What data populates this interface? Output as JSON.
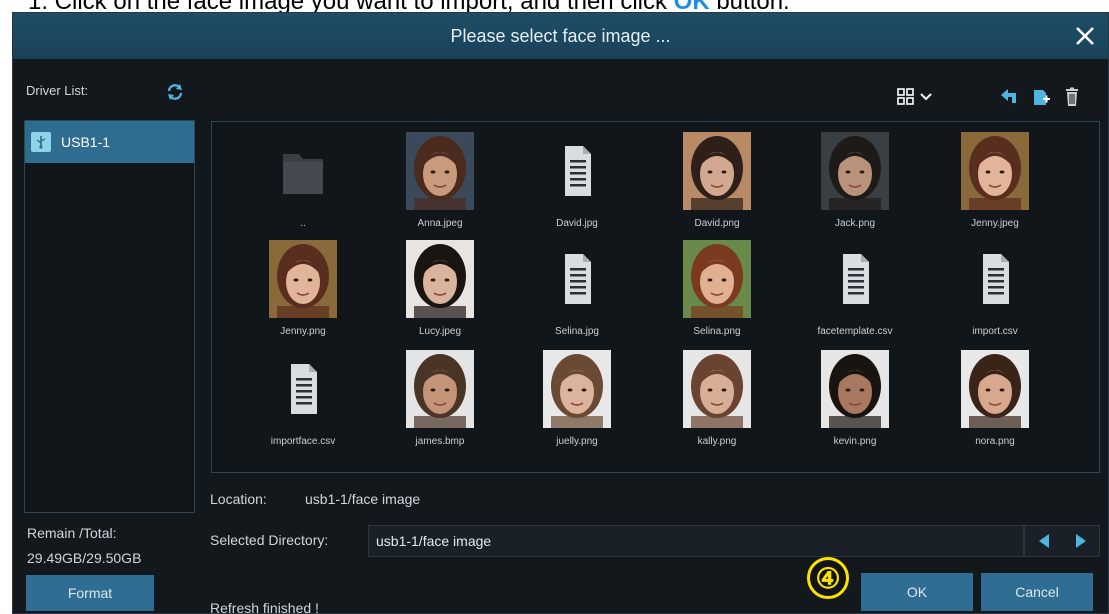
{
  "instruction": {
    "prefix": "1. Click on the face image you want to import, and then click ",
    "highlight": "OK",
    "suffix": " button."
  },
  "dialog": {
    "title": "Please select face image ...",
    "close_icon": "close-icon"
  },
  "drivers": {
    "label": "Driver List:",
    "items": [
      {
        "label": "USB1-1",
        "icon": "usb-icon"
      }
    ]
  },
  "storage": {
    "remain_label": "Remain /Total:",
    "remain_value": "29.49GB/29.50GB",
    "format_label": "Format"
  },
  "toolbar": {
    "view_icon": "grid-view-icon",
    "back_icon": "back-arrow-icon",
    "new_folder_icon": "new-folder-icon",
    "delete_icon": "trash-icon"
  },
  "files": [
    {
      "name": "..",
      "kind": "folder"
    },
    {
      "name": "Anna.jpeg",
      "kind": "face",
      "skin": "#c99a7c",
      "hair": "#4a2b1e",
      "bg": "#3b4a5a"
    },
    {
      "name": "David.jpg",
      "kind": "doc"
    },
    {
      "name": "David.png",
      "kind": "face",
      "skin": "#d2a890",
      "hair": "#2e2018",
      "bg": "#b88a66"
    },
    {
      "name": "Jack.png",
      "kind": "face",
      "skin": "#b8927a",
      "hair": "#1e1a18",
      "bg": "#3a3f44"
    },
    {
      "name": "Jenny.jpeg",
      "kind": "face",
      "skin": "#e2b49a",
      "hair": "#5a2e1e",
      "bg": "#8a6a3a"
    },
    {
      "name": "Jenny.png",
      "kind": "face",
      "skin": "#e2b49a",
      "hair": "#5a2e1e",
      "bg": "#8a6a3a"
    },
    {
      "name": "Lucy.jpeg",
      "kind": "face",
      "skin": "#d9b39c",
      "hair": "#1b1512",
      "bg": "#e8e4e0"
    },
    {
      "name": "Selina.jpg",
      "kind": "doc"
    },
    {
      "name": "Selina.png",
      "kind": "face",
      "skin": "#e0b090",
      "hair": "#7a3a20",
      "bg": "#6a8a4a"
    },
    {
      "name": "facetemplate.csv",
      "kind": "doc"
    },
    {
      "name": "import.csv",
      "kind": "doc"
    },
    {
      "name": "importface.csv",
      "kind": "doc"
    },
    {
      "name": "james.bmp",
      "kind": "face",
      "skin": "#c49478",
      "hair": "#4a3426",
      "bg": "#e4e4e4"
    },
    {
      "name": "juelly.png",
      "kind": "face",
      "skin": "#dcb49e",
      "hair": "#6a4a32",
      "bg": "#e8e8e8"
    },
    {
      "name": "kally.png",
      "kind": "face",
      "skin": "#d8ae96",
      "hair": "#6a4430",
      "bg": "#e6e6e6"
    },
    {
      "name": "kevin.png",
      "kind": "face",
      "skin": "#a87860",
      "hair": "#1a1410",
      "bg": "#e6e6e6"
    },
    {
      "name": "nora.png",
      "kind": "face",
      "skin": "#d8a88e",
      "hair": "#3a2418",
      "bg": "#e8e8e8"
    }
  ],
  "location": {
    "label": "Location:",
    "value": "usb1-1/face image"
  },
  "selected_directory": {
    "label": "Selected Directory:",
    "value": "usb1-1/face image"
  },
  "status": "Refresh finished !",
  "buttons": {
    "ok": "OK",
    "cancel": "Cancel"
  },
  "step_badge": "④",
  "colors": {
    "accent": "#2f6d92",
    "title_bg": "#1f4d66",
    "background": "#13181d",
    "icon_blue": "#4fb4e0",
    "badge": "#ffe200"
  }
}
